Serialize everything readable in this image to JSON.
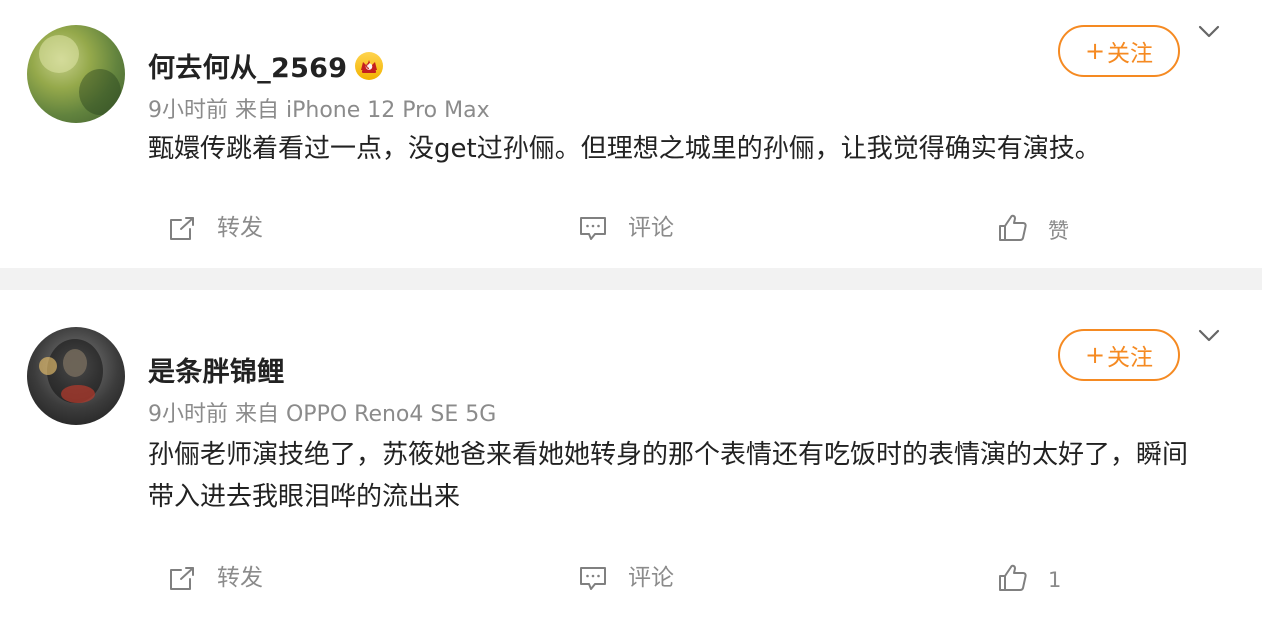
{
  "colors": {
    "follow_accent": "#f58a22",
    "text_primary": "#222222",
    "text_secondary": "#8b8b8b",
    "separator": "#f2f2f2"
  },
  "posts": [
    {
      "username": "何去何从_2569",
      "badge_icon": "crown-badge-icon",
      "time": "9小时前",
      "source": "来自 iPhone 12 Pro Max",
      "content": "甄嬛传跳着看过一点，没get过孙俪。但理想之城里的孙俪，让我觉得确实有演技。",
      "follow_button": {
        "plus": "+",
        "label": "关注"
      },
      "actions": {
        "forward": "转发",
        "comment": "评论",
        "like": "赞"
      }
    },
    {
      "username": "是条胖锦鲤",
      "time": "9小时前",
      "source": "来自 OPPO Reno4 SE 5G",
      "content": "孙俪老师演技绝了，苏筱她爸来看她她转身的那个表情还有吃饭时的表情演的太好了，瞬间带入进去我眼泪哗的流出来",
      "follow_button": {
        "plus": "+",
        "label": "关注"
      },
      "actions": {
        "forward": "转发",
        "comment": "评论",
        "like": "1"
      }
    }
  ]
}
